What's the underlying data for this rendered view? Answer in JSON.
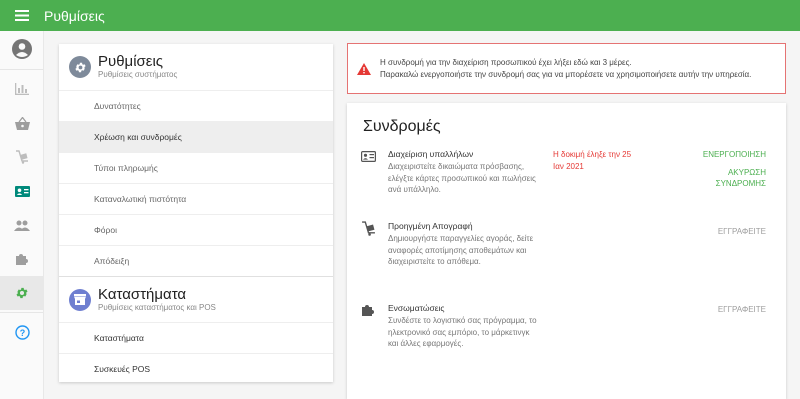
{
  "header": {
    "title": "Ρυθμίσεις"
  },
  "rail": {
    "items": [
      "account-icon",
      "reports-icon",
      "basket-icon",
      "inventory-icon",
      "staff-card-icon",
      "users-icon",
      "puzzle-icon",
      "settings-icon",
      "help-icon"
    ],
    "active_color": "#4caf50",
    "help_color": "#2196f3"
  },
  "settings_section": {
    "title": "Ρυθμίσεις",
    "subtitle": "Ρυθμίσεις συστήματος",
    "items": [
      "Δυνατότητες",
      "Χρέωση και συνδρομές",
      "Τύποι πληρωμής",
      "Καταναλωτική πιστότητα",
      "Φόροι",
      "Απόδειξη"
    ]
  },
  "stores_section": {
    "title": "Καταστήματα",
    "subtitle": "Ρυθμίσεις καταστήματος και POS",
    "items": [
      "Καταστήματα",
      "Συσκευές POS"
    ]
  },
  "alert": {
    "line1": "Η συνδρομή για την διαχείριση προσωπικού έχει λήξει εδώ και 3 μέρες.",
    "line2": "Παρακαλώ ενεργοποιήστε την συνδρομή σας για να μπορέσετε να χρησιμοποιήσετε αυτήν την υπηρεσία."
  },
  "subscriptions": {
    "heading": "Συνδρομές",
    "rows": [
      {
        "name": "Διαχείριση υπαλλήλων",
        "desc": "Διαχειριστείτε δικαιώματα πρόσβασης, ελέγξτε κάρτες προσωπικού και πωλήσεις ανά υπάλληλο.",
        "status": "Η δοκιμή έληξε την 25 Ιαν 2021",
        "action": "ΕΝΕΡΓΟΠΟΙΗΣΗ",
        "action2": "ΑΚΥΡΩΣΗ ΣΥΝΔΡΟΜΗΣ"
      },
      {
        "name": "Προηγμένη Απογραφή",
        "desc": "Δημιουργήστε παραγγελίες αγοράς, δείτε αναφορές αποτίμησης αποθεμάτων και διαχειριστείτε το απόθεμα.",
        "action": "ΕΓΓΡΑΦΕΙΤΕ"
      },
      {
        "name": "Ενσωματώσεις",
        "desc": "Συνδέστε το λογιστικό σας πρόγραμμα, το ηλεκτρονικό σας εμπόριο, το μάρκετινγκ και άλλες εφαρμογές.",
        "action": "ΕΓΓΡΑΦΕΙΤΕ"
      }
    ]
  }
}
